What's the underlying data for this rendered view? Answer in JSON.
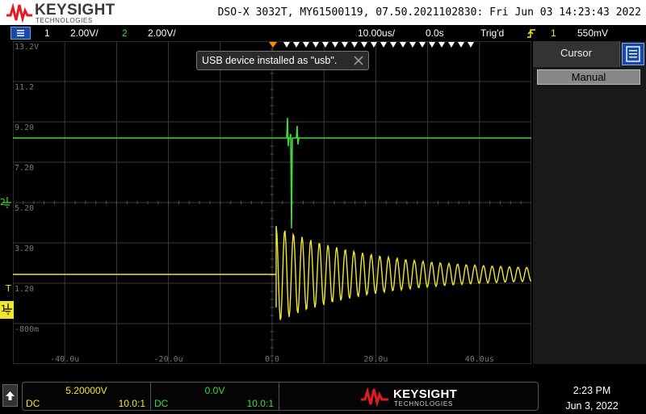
{
  "header": {
    "brand": "KEYSIGHT",
    "brand_sub": "TECHNOLOGIES",
    "title": "DSO-X 3032T, MY61500119, 07.50.2021102830: Fri Jun 03 14:23:43 2022"
  },
  "status": {
    "ch1_num": "1",
    "ch1_scale": "2.00V/",
    "ch2_num": "2",
    "ch2_scale": "2.00V/",
    "timebase": "10.00us/",
    "delay": "0.0s",
    "trigger": "Trig'd",
    "trig_source": "1",
    "trig_level": "550mV"
  },
  "plot": {
    "y_labels": [
      "13.2V",
      "11.2",
      "9.20",
      "7.20",
      "5.20",
      "3.20",
      "1.20",
      "-800m"
    ],
    "x_labels": [
      "-40.0u",
      "-20.0u",
      "0.0",
      "20.0u",
      "40.0us"
    ]
  },
  "toast": {
    "text": "USB device installed as \"usb\"."
  },
  "right_panel": {
    "tab": "Cursor",
    "button": "Manual"
  },
  "channels": {
    "ch1": {
      "value": "5.20000V",
      "coupling": "DC",
      "probe": "10.0:1"
    },
    "ch2": {
      "value": "0.0V",
      "coupling": "DC",
      "probe": "10.0:1"
    }
  },
  "clock": {
    "time": "2:23 PM",
    "date": "Jun 3, 2022"
  },
  "colors": {
    "ch1": "#f0e62a",
    "ch2": "#3ed83e",
    "grid": "#3a3a3a",
    "accent": "#1a4aa8",
    "trigger": "#ff8c00"
  }
}
